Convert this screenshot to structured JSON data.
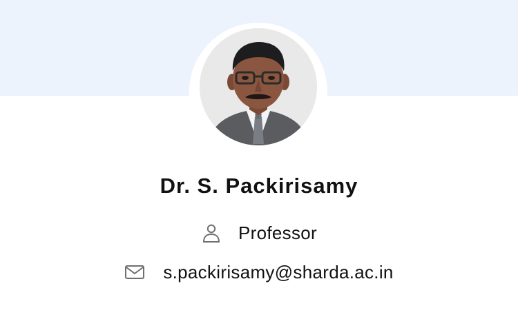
{
  "profile": {
    "name": "Dr. S. Packirisamy",
    "role": "Professor",
    "email": "s.packirisamy@sharda.ac.in"
  },
  "icons": {
    "role": "user-icon",
    "email": "mail-icon"
  },
  "colors": {
    "banner_bg": "#edf3fc",
    "text": "#111111",
    "icon": "#6f6f6f"
  }
}
